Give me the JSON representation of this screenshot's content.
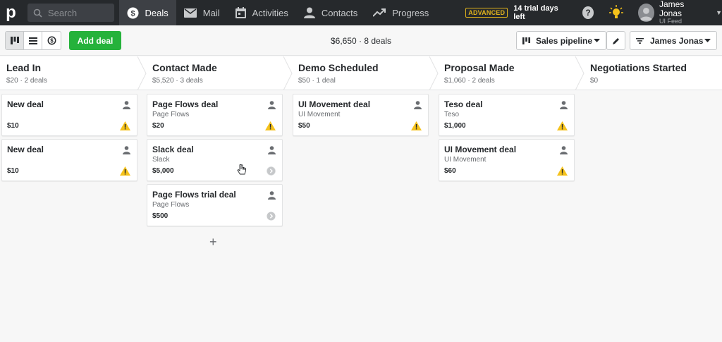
{
  "topbar": {
    "logo": "p",
    "search_placeholder": "Search",
    "nav": [
      {
        "label": "Deals",
        "icon": "dollar-circle-icon",
        "active": true
      },
      {
        "label": "Mail",
        "icon": "mail-icon",
        "active": false
      },
      {
        "label": "Activities",
        "icon": "calendar-icon",
        "active": false
      },
      {
        "label": "Contacts",
        "icon": "person-icon",
        "active": false
      },
      {
        "label": "Progress",
        "icon": "trend-icon",
        "active": false
      }
    ],
    "plan_badge": "ADVANCED",
    "trial_text": "14 trial days left",
    "help_glyph": "?",
    "user": {
      "name": "James Jonas",
      "company": "UI Feed"
    }
  },
  "toolbar": {
    "add_deal_label": "Add deal",
    "summary": "$6,650 · 8 deals",
    "pipeline_label": "Sales pipeline",
    "owner_label": "James Jonas"
  },
  "stages": [
    {
      "name": "Lead In",
      "meta": "$20 · 2 deals",
      "deals": [
        {
          "title": "New deal",
          "org": "",
          "value": "$10",
          "status": "warning"
        },
        {
          "title": "New deal",
          "org": "",
          "value": "$10",
          "status": "warning"
        }
      ]
    },
    {
      "name": "Contact Made",
      "meta": "$5,520 · 3 deals",
      "deals": [
        {
          "title": "Page Flows deal",
          "org": "Page Flows",
          "value": "$20",
          "status": "warning"
        },
        {
          "title": "Slack deal",
          "org": "Slack",
          "value": "$5,000",
          "status": "next"
        },
        {
          "title": "Page Flows trial deal",
          "org": "Page Flows",
          "value": "$500",
          "status": "next"
        }
      ]
    },
    {
      "name": "Demo Scheduled",
      "meta": "$50 · 1 deal",
      "deals": [
        {
          "title": "UI Movement deal",
          "org": "UI Movement",
          "value": "$50",
          "status": "warning"
        }
      ]
    },
    {
      "name": "Proposal Made",
      "meta": "$1,060 · 2 deals",
      "deals": [
        {
          "title": "Teso deal",
          "org": "Teso",
          "value": "$1,000",
          "status": "warning"
        },
        {
          "title": "UI Movement deal",
          "org": "UI Movement",
          "value": "$60",
          "status": "warning"
        }
      ]
    },
    {
      "name": "Negotiations Started",
      "meta": "$0",
      "deals": []
    }
  ],
  "colors": {
    "topbar": "#26292c",
    "accent_green": "#25b23b",
    "warning": "#f5c21b",
    "badge": "#e0b31c"
  },
  "add_glyph": "+"
}
